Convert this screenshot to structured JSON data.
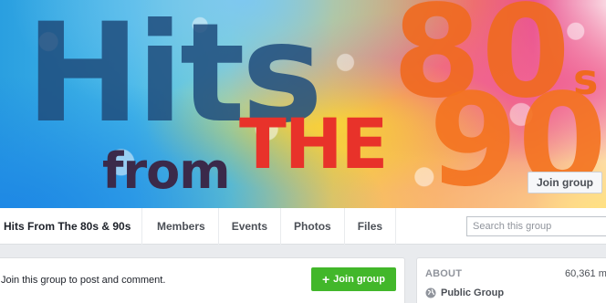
{
  "cover": {
    "art_hits": "Hits",
    "art_from": "from",
    "art_the": "THE",
    "art_80": "80",
    "art_s": "s",
    "art_90": "90",
    "join_button_label": "Join group"
  },
  "nav": {
    "group_name": "Hits From The 80s & 90s",
    "tabs": [
      {
        "label": "Members"
      },
      {
        "label": "Events"
      },
      {
        "label": "Photos"
      },
      {
        "label": "Files"
      }
    ],
    "search_placeholder": "Search this group"
  },
  "composer": {
    "prompt": "Join this group to post and comment.",
    "join_button_label": "Join group",
    "join_button_icon": "plus-icon"
  },
  "about": {
    "title": "ABOUT",
    "members": "60,361 m",
    "privacy_icon": "globe-icon",
    "privacy_label": "Public Group"
  },
  "colors": {
    "join_green": "#42b72a",
    "page_bg": "#e9ebee"
  }
}
